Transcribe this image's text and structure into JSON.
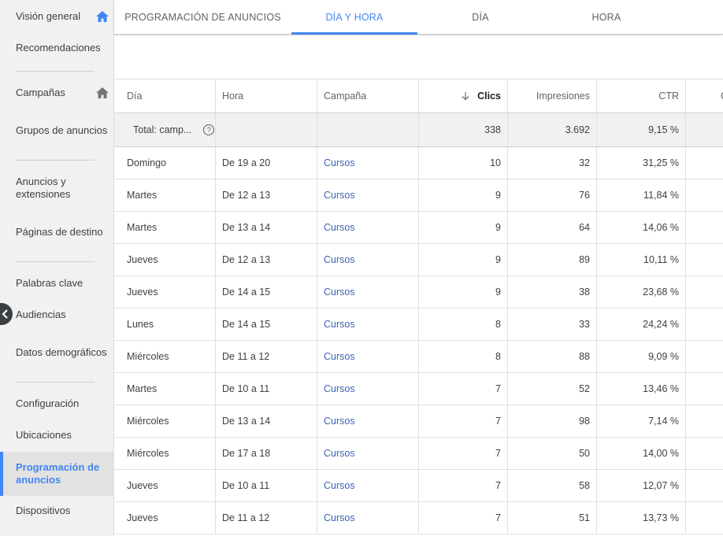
{
  "sidebar": {
    "items": [
      {
        "label": "Visión general"
      },
      {
        "label": "Recomendaciones"
      },
      {
        "label": "Campañas"
      },
      {
        "label": "Grupos de anuncios"
      },
      {
        "label": "Anuncios y extensiones"
      },
      {
        "label": "Páginas de destino"
      },
      {
        "label": "Palabras clave"
      },
      {
        "label": "Audiencias"
      },
      {
        "label": "Datos demográficos"
      },
      {
        "label": "Configuración"
      },
      {
        "label": "Ubicaciones"
      },
      {
        "label": "Programación de anuncios"
      },
      {
        "label": "Dispositivos"
      }
    ]
  },
  "tabs": [
    {
      "label": "PROGRAMACIÓN DE ANUNCIOS"
    },
    {
      "label": "DÍA Y HORA"
    },
    {
      "label": "DÍA"
    },
    {
      "label": "HORA"
    }
  ],
  "table": {
    "headers": {
      "dia": "Día",
      "hora": "Hora",
      "campana": "Campaña",
      "clics": "Clics",
      "impresiones": "Impresiones",
      "ctr": "CTR",
      "extra": "C"
    },
    "total": {
      "label": "Total: camp...",
      "help": "?",
      "clics": "338",
      "impresiones": "3.692",
      "ctr": "9,15 %"
    },
    "rows": [
      {
        "dia": "Domingo",
        "hora": "De 19 a 20",
        "campana": "Cursos",
        "clics": "10",
        "impresiones": "32",
        "ctr": "31,25 %"
      },
      {
        "dia": "Martes",
        "hora": "De 12 a 13",
        "campana": "Cursos",
        "clics": "9",
        "impresiones": "76",
        "ctr": "11,84 %"
      },
      {
        "dia": "Martes",
        "hora": "De 13 a 14",
        "campana": "Cursos",
        "clics": "9",
        "impresiones": "64",
        "ctr": "14,06 %"
      },
      {
        "dia": "Jueves",
        "hora": "De 12 a 13",
        "campana": "Cursos",
        "clics": "9",
        "impresiones": "89",
        "ctr": "10,11 %"
      },
      {
        "dia": "Jueves",
        "hora": "De 14 a 15",
        "campana": "Cursos",
        "clics": "9",
        "impresiones": "38",
        "ctr": "23,68 %"
      },
      {
        "dia": "Lunes",
        "hora": "De 14 a 15",
        "campana": "Cursos",
        "clics": "8",
        "impresiones": "33",
        "ctr": "24,24 %"
      },
      {
        "dia": "Miércoles",
        "hora": "De 11 a 12",
        "campana": "Cursos",
        "clics": "8",
        "impresiones": "88",
        "ctr": "9,09 %"
      },
      {
        "dia": "Martes",
        "hora": "De 10 a 11",
        "campana": "Cursos",
        "clics": "7",
        "impresiones": "52",
        "ctr": "13,46 %"
      },
      {
        "dia": "Miércoles",
        "hora": "De 13 a 14",
        "campana": "Cursos",
        "clics": "7",
        "impresiones": "98",
        "ctr": "7,14 %"
      },
      {
        "dia": "Miércoles",
        "hora": "De 17 a 18",
        "campana": "Cursos",
        "clics": "7",
        "impresiones": "50",
        "ctr": "14,00 %"
      },
      {
        "dia": "Jueves",
        "hora": "De 10 a 11",
        "campana": "Cursos",
        "clics": "7",
        "impresiones": "58",
        "ctr": "12,07 %"
      },
      {
        "dia": "Jueves",
        "hora": "De 11 a 12",
        "campana": "Cursos",
        "clics": "7",
        "impresiones": "51",
        "ctr": "13,73 %"
      }
    ]
  },
  "colors": {
    "accent": "#4285f4",
    "link": "#3b63b8",
    "sidebar_bg": "#f1f1f1"
  },
  "icons": {
    "home": "home-icon",
    "collapse": "chevron-left-icon",
    "sort": "arrow-down-icon",
    "help": "help-circle-icon"
  }
}
